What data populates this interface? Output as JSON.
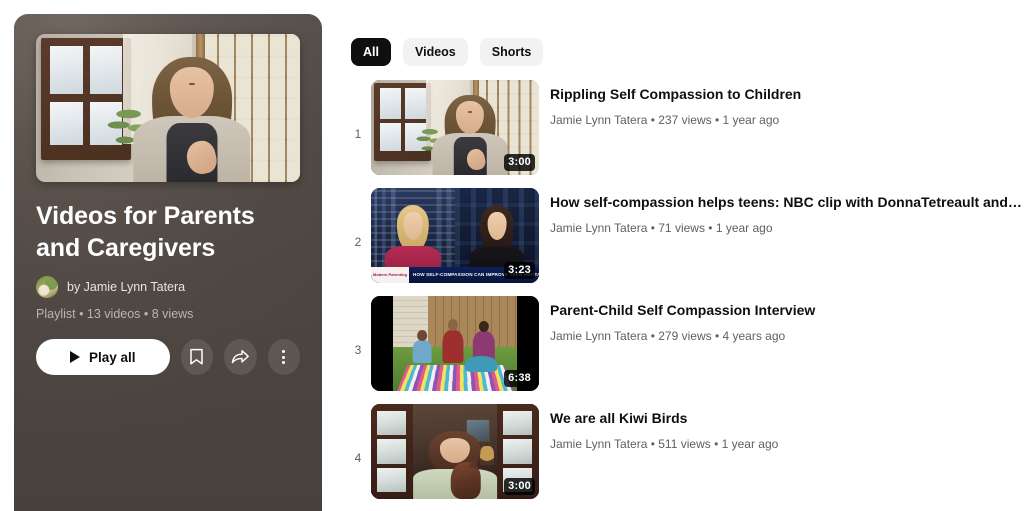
{
  "playlist": {
    "title": "Videos for Parents and Caregivers",
    "owner_prefix": "by ",
    "owner": "by Jamie Lynn Tatera",
    "meta": "Playlist • 13 videos • 8 views",
    "play_all_label": "Play all",
    "actions": [
      {
        "name": "save-to-library-button",
        "icon": "bookmark-icon"
      },
      {
        "name": "share-button",
        "icon": "share-arrow-icon"
      },
      {
        "name": "more-options-button",
        "icon": "three-dots-icon"
      }
    ],
    "avatar_icon": "channel-avatar",
    "hero_thumbnail": "woman-at-window-thumbnail"
  },
  "filters": {
    "chips": [
      {
        "label": "All",
        "selected": true
      },
      {
        "label": "Videos",
        "selected": false
      },
      {
        "label": "Shorts",
        "selected": false
      }
    ]
  },
  "videos": [
    {
      "index": "1",
      "title": "Rippling Self Compassion to Children",
      "meta": "Jamie Lynn Tatera • 237 views • 1 year ago",
      "channel": "Jamie Lynn Tatera",
      "views": "237 views",
      "age": "1 year ago",
      "duration": "3:00",
      "thumbnail": "woman-at-window-thumbnail"
    },
    {
      "index": "2",
      "title": "How self-compassion helps teens: NBC clip with DonnaTetreault and KarenBluth",
      "meta": "Jamie Lynn Tatera • 71 views • 1 year ago",
      "channel": "Jamie Lynn Tatera",
      "views": "71 views",
      "age": "1 year ago",
      "duration": "3:23",
      "thumbnail": "news-split-screen-thumbnail",
      "chyron_logo": "Modern Parenting",
      "chyron_headline": "HOW SELF-COMPASSION CAN IMPROVE TEEN MENTAL HEA"
    },
    {
      "index": "3",
      "title": "Parent-Child Self Compassion Interview",
      "meta": "Jamie Lynn Tatera • 279 views • 4 years ago",
      "channel": "Jamie Lynn Tatera",
      "views": "279 views",
      "age": "4 years ago",
      "duration": "6:38",
      "thumbnail": "backyard-kids-blanket-thumbnail"
    },
    {
      "index": "4",
      "title": "We are all Kiwi Birds",
      "meta": "Jamie Lynn Tatera • 511 views • 1 year ago",
      "channel": "Jamie Lynn Tatera",
      "views": "511 views",
      "age": "1 year ago",
      "duration": "3:00",
      "thumbnail": "woman-with-cat-doorway-thumbnail"
    }
  ],
  "colors": {
    "panel_background": "#524a45",
    "page_background": "#ffffff",
    "chip_selected_bg": "#0f0f0f",
    "chip_bg": "#f2f2f2",
    "primary_text": "#0f0f0f",
    "secondary_text": "#606060",
    "play_button_bg": "#ffffff"
  }
}
